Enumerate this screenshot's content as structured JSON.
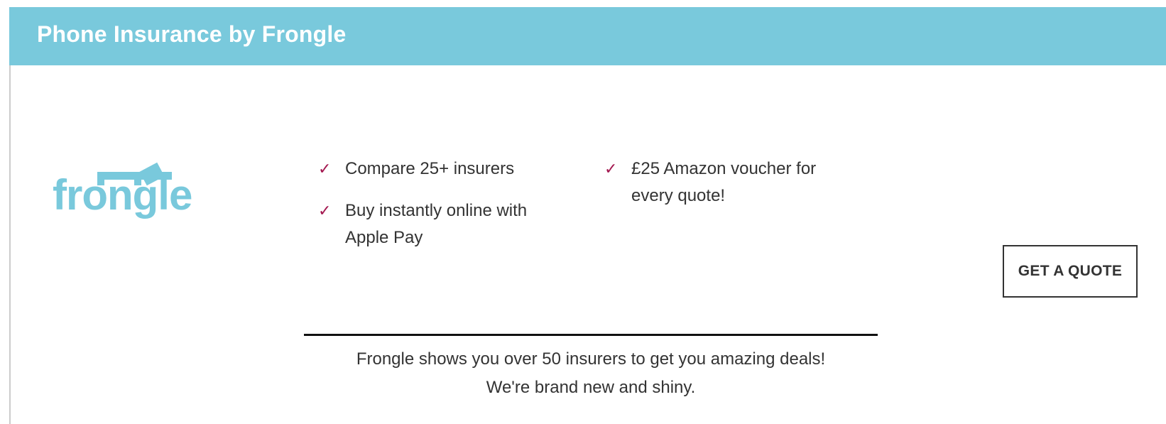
{
  "header": {
    "title": "Phone Insurance by Frongle"
  },
  "logo": {
    "text": "frongle"
  },
  "features": {
    "left": [
      {
        "check_icon": "✓",
        "text": "Compare 25+ insurers"
      },
      {
        "check_icon": "✓",
        "text": "Buy instantly online with\nApple Pay"
      }
    ],
    "right": [
      {
        "check_icon": "✓",
        "text": "£25 Amazon voucher for\nevery quote!"
      }
    ]
  },
  "cta": {
    "label": "GET A QUOTE"
  },
  "tagline": {
    "line1": "Frongle shows you over 50 insurers to get you amazing deals!",
    "line2": "We're brand new and shiny."
  },
  "colors": {
    "header_bg": "#79c9dc",
    "brand": "#79c9dc",
    "check": "#a3174f",
    "text": "#333333"
  }
}
